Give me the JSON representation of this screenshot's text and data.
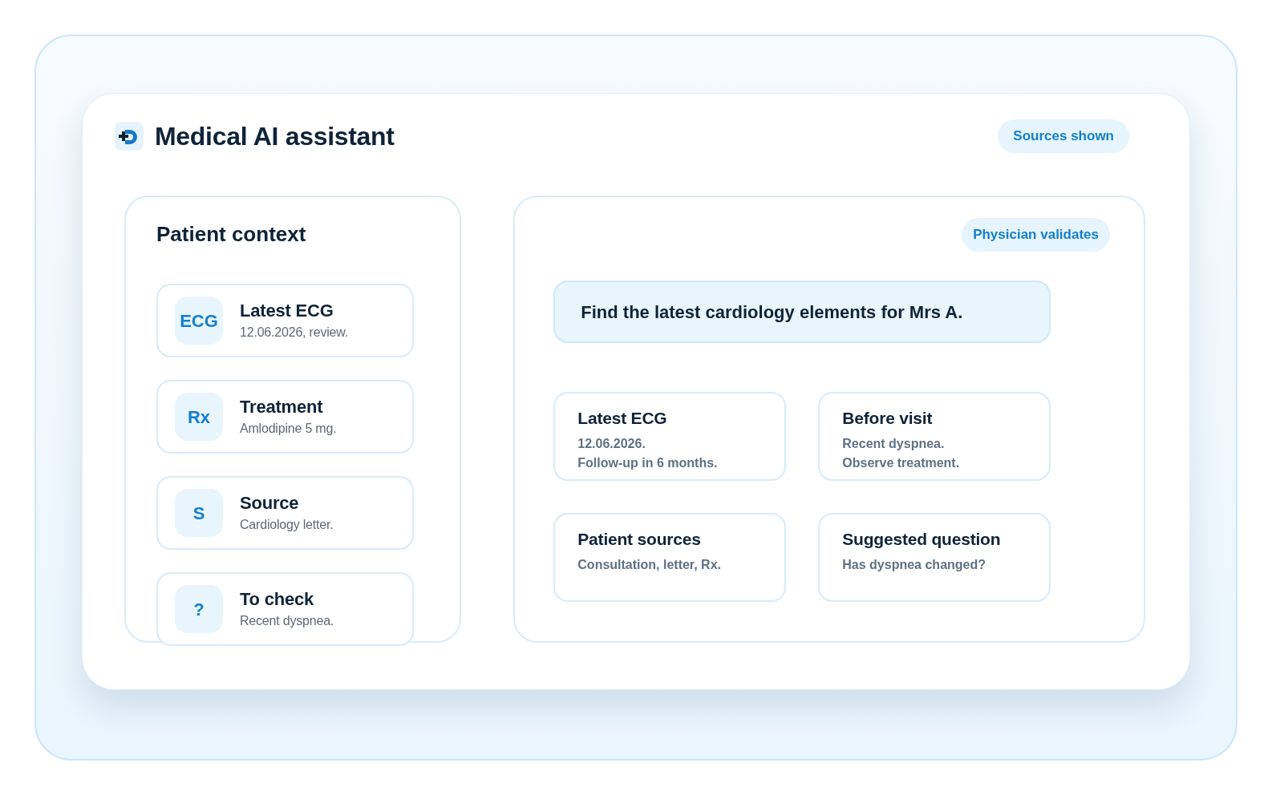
{
  "header": {
    "title": "Medical AI assistant",
    "badge": "Sources shown"
  },
  "patient_context": {
    "title": "Patient context",
    "items": [
      {
        "tile": "ECG",
        "title": "Latest ECG",
        "detail": "12.06.2026, review."
      },
      {
        "tile": "Rx",
        "title": "Treatment",
        "detail": "Amlodipine 5 mg."
      },
      {
        "tile": "S",
        "title": "Source",
        "detail": "Cardiology letter."
      },
      {
        "tile": "?",
        "title": "To check",
        "detail": "Recent dyspnea."
      }
    ]
  },
  "assistant": {
    "badge": "Physician validates",
    "query": "Find the latest cardiology elements for Mrs A.",
    "cards": [
      {
        "title": "Latest ECG",
        "lines": [
          "12.06.2026.",
          "Follow-up in 6 months."
        ]
      },
      {
        "title": "Before visit",
        "lines": [
          "Recent dyspnea.",
          "Observe treatment."
        ]
      },
      {
        "title": "Patient sources",
        "lines": [
          "Consultation, letter, Rx."
        ]
      },
      {
        "title": "Suggested question",
        "lines": [
          "Has dyspnea changed?"
        ]
      }
    ]
  }
}
